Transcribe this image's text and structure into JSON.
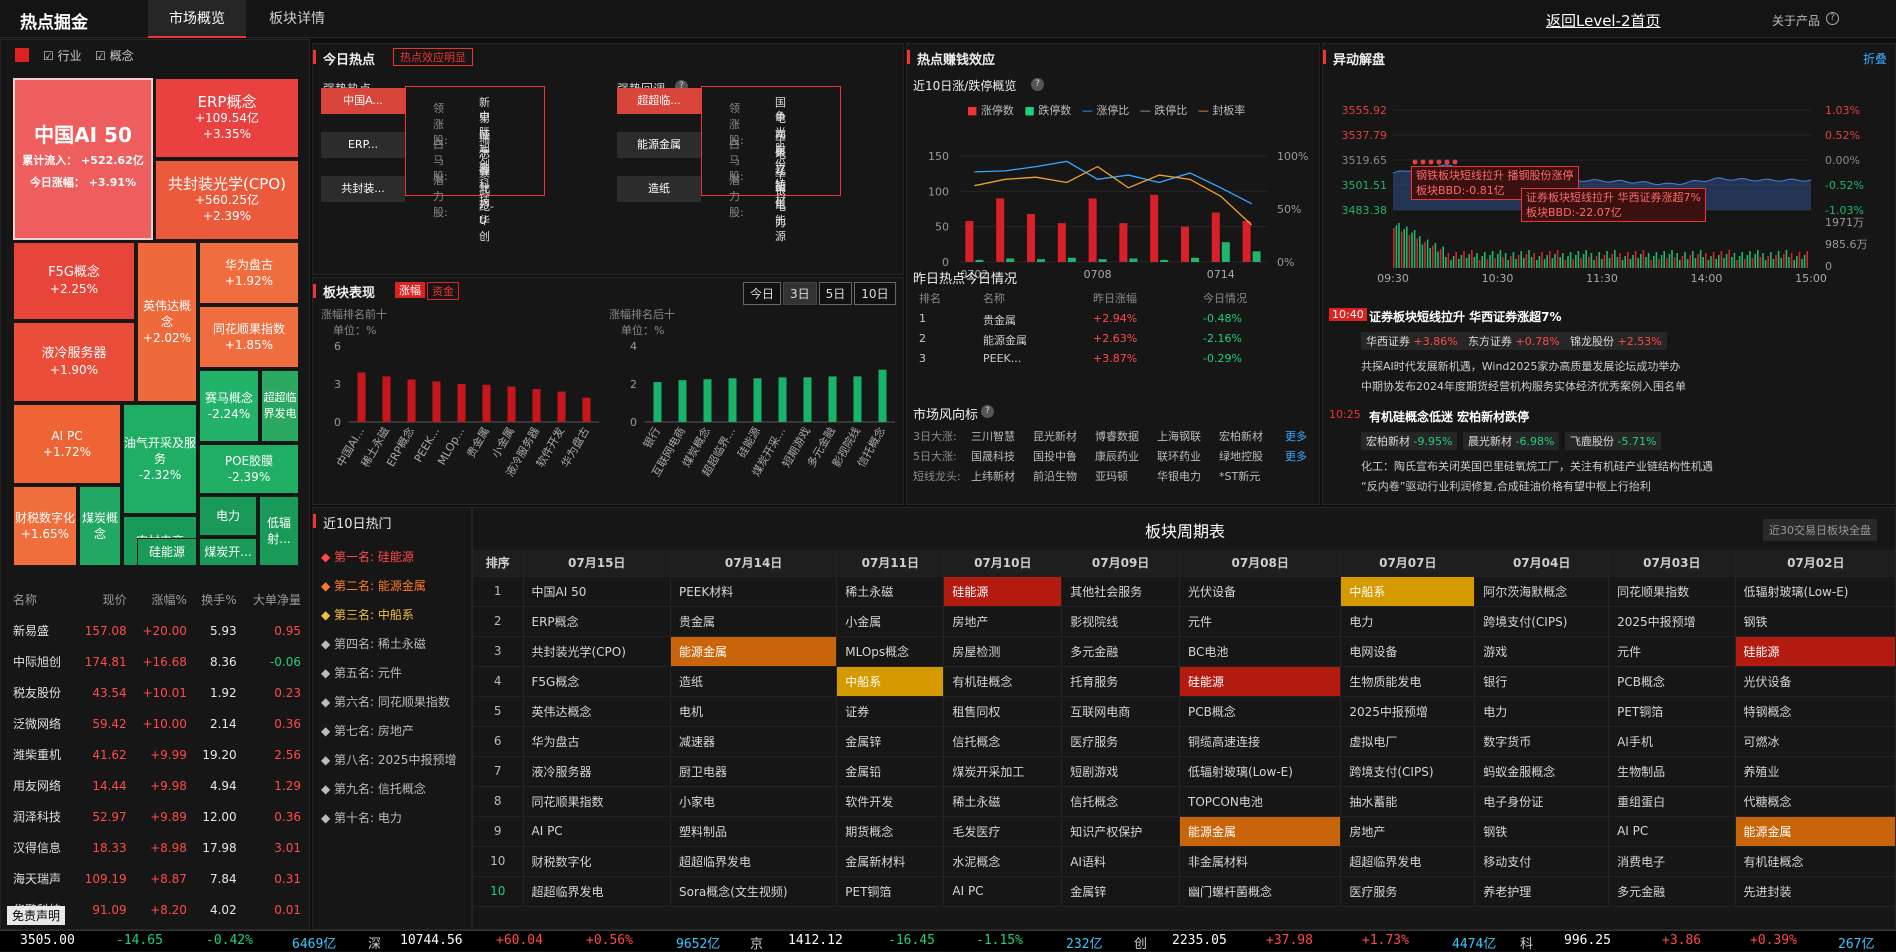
{
  "app": {
    "title": "热点掘金",
    "tabs": [
      "市场概览",
      "板块详情"
    ],
    "back_link": "返回Level-2首页",
    "about": "关于产品",
    "help": "?"
  },
  "left": {
    "filters": [
      "行业",
      "概念"
    ],
    "treemap": [
      {
        "name": "中国AI 50",
        "l1": "累计流入：",
        "v1": "+522.62亿",
        "l2": "今日涨幅：",
        "v2": "+3.91%"
      },
      {
        "name": "ERP概念",
        "v1": "+109.54亿",
        "v2": "+3.35%"
      },
      {
        "name": "共封装光学(CPO)",
        "v1": "+560.25亿",
        "v2": "+2.39%"
      },
      {
        "name": "F5G概念",
        "v1": "+2.25%"
      },
      {
        "name": "英伟达概念",
        "v1": "+2.02%"
      },
      {
        "name": "华为盘古",
        "v1": "+1.92%"
      },
      {
        "name": "同花顺果指数",
        "v1": "+1.85%"
      },
      {
        "name": "液冷服务器",
        "v1": "+1.90%"
      },
      {
        "name": "赛马概念",
        "v1": "-2.24%"
      },
      {
        "name": "超超临界发电",
        "v1": ""
      },
      {
        "name": "AI PC",
        "v1": "+1.72%"
      },
      {
        "name": "油气开采及服务",
        "v1": "-2.32%"
      },
      {
        "name": "POE胶膜",
        "v1": "-2.39%"
      },
      {
        "name": "财税数字化",
        "v1": "+1.65%"
      },
      {
        "name": "煤炭概念",
        "v1": ""
      },
      {
        "name": "农村电商",
        "v1": ""
      },
      {
        "name": "电力",
        "v1": ""
      },
      {
        "name": "低辐射...",
        "v1": ""
      },
      {
        "name": "硅能源",
        "v1": ""
      },
      {
        "name": "煤炭开...",
        "v1": ""
      }
    ],
    "stock_headers": [
      "名称",
      "现价",
      "涨幅%",
      "换手%",
      "大单净量"
    ],
    "stocks": [
      [
        "新易盛",
        "157.08",
        "+20.00",
        "5.93",
        "0.95"
      ],
      [
        "中际旭创",
        "174.81",
        "+16.68",
        "8.36",
        "-0.06"
      ],
      [
        "税友股份",
        "43.54",
        "+10.01",
        "1.92",
        "0.23"
      ],
      [
        "泛微网络",
        "59.42",
        "+10.00",
        "2.14",
        "0.36"
      ],
      [
        "潍柴重机",
        "41.62",
        "+9.99",
        "19.20",
        "2.56"
      ],
      [
        "用友网络",
        "14.44",
        "+9.98",
        "4.94",
        "1.29"
      ],
      [
        "润泽科技",
        "52.97",
        "+9.89",
        "12.00",
        "0.36"
      ],
      [
        "汉得信息",
        "18.33",
        "+8.98",
        "17.98",
        "3.01"
      ],
      [
        "海天瑞声",
        "109.19",
        "+8.87",
        "7.84",
        "0.31"
      ],
      [
        "华鹏科技",
        "91.09",
        "+8.20",
        "4.02",
        "0.01"
      ]
    ],
    "disclaimer": "免责声明"
  },
  "hot": {
    "title": "今日热点",
    "badge": "热点效应明显",
    "strong_label": "强势热点",
    "pullback_label": "强势回调",
    "strong": [
      "中国A...",
      "ERP...",
      "共封装..."
    ],
    "pullback": [
      "超超临...",
      "能源金属",
      "造纸"
    ],
    "roles": [
      "领涨股:",
      "白马股:",
      "潜力股:"
    ],
    "strong_stocks": [
      [
        "新易盛",
        "中际旭创"
      ],
      [
        "瑞芯微",
        "乐鑫科技"
      ],
      [
        "寒武纪-U",
        "北方华创"
      ]
    ],
    "pull_stocks": [
      [
        "国电南自",
        "争光股份"
      ],
      [
        "华电辽能",
        "久立特材"
      ],
      [
        "华银电力",
        "华电能源"
      ]
    ]
  },
  "money": {
    "title": "热点赚钱效应",
    "sub": "近10日涨/跌停概览",
    "legend": [
      "涨停数",
      "跌停数",
      "涨停比",
      "跌停比",
      "封板率"
    ],
    "left_ticks": [
      "150",
      "100",
      "50",
      "0"
    ],
    "right_ticks": [
      "100%",
      "50%",
      "0%"
    ],
    "x_ticks": [
      "0702",
      "0708",
      "0714"
    ],
    "yest_title": "昨日热点今日情况",
    "yest_headers": [
      "排名",
      "名称",
      "昨日涨幅",
      "今日情况"
    ],
    "yest_rows": [
      [
        "1",
        "贵金属",
        "+2.94%",
        "-0.48%"
      ],
      [
        "2",
        "能源金属",
        "+2.63%",
        "-2.16%"
      ],
      [
        "3",
        "PEEK...",
        "+3.87%",
        "-0.29%"
      ]
    ],
    "wind_title": "市场风向标",
    "wind_rows": [
      {
        "label": "3日大涨:",
        "items": [
          "三川智慧",
          "昆光新材",
          "博睿数据",
          "上海钢联",
          "宏柏新材"
        ],
        "more": "更多"
      },
      {
        "label": "5日大涨:",
        "items": [
          "国晟科技",
          "国投中鲁",
          "康辰药业",
          "联环药业",
          "绿地控股"
        ],
        "more": "更多"
      },
      {
        "label": "短线龙头:",
        "items": [
          "上纬新材",
          "前沿生物",
          "亚玛顿",
          "华银电力",
          "*ST新元"
        ],
        "more": ""
      }
    ]
  },
  "perf": {
    "title": "板块表现",
    "tab1": "涨幅",
    "tab2": "资金",
    "periods": [
      "今日",
      "3日",
      "5日",
      "10日"
    ],
    "top_label": "涨幅排名前十",
    "bottom_label": "涨幅排名后十",
    "unit": "单位：%",
    "top_ticks": [
      "6",
      "3",
      "0"
    ],
    "bot_ticks": [
      "4",
      "2",
      "0"
    ],
    "top_names": [
      "中国AI...",
      "稀土永磁",
      "ERP概念",
      "PEEK...",
      "MLOp...",
      "贵金属",
      "小金属",
      "液冷服务器",
      "软件开发",
      "华为盘古"
    ],
    "bot_names": [
      "银行",
      "互联网电商",
      "煤炭概念",
      "超超临界...",
      "硅能源",
      "煤炭开采...",
      "短期游戏",
      "多元金融",
      "影视院线",
      "信托概念"
    ]
  },
  "chart_data": [
    {
      "type": "bar",
      "title": "涨幅排名前十",
      "ylabel": "单位：%",
      "categories": [
        "中国AI...",
        "稀土永磁",
        "ERP概念",
        "PEEK...",
        "MLOp...",
        "贵金属",
        "小金属",
        "液冷服务器",
        "软件开发",
        "华为盘古"
      ],
      "values": [
        3.91,
        3.6,
        3.35,
        3.2,
        3.0,
        2.94,
        2.8,
        2.6,
        2.4,
        1.92
      ],
      "ylim": [
        0,
        6
      ]
    },
    {
      "type": "bar",
      "title": "涨幅排名后十",
      "ylabel": "单位：%",
      "categories": [
        "银行",
        "互联网电商",
        "煤炭概念",
        "超超临界...",
        "硅能源",
        "煤炭开采...",
        "短期游戏",
        "多元金融",
        "影视院线",
        "信托概念"
      ],
      "values": [
        2.1,
        2.2,
        2.25,
        2.3,
        2.3,
        2.35,
        2.35,
        2.4,
        2.4,
        2.75
      ],
      "ylim": [
        0,
        4
      ]
    },
    {
      "type": "bar",
      "title": "近10日涨/跌停概览",
      "x": [
        "0702",
        "0703",
        "0704",
        "0707",
        "0708",
        "0709",
        "0710",
        "0711",
        "0714",
        "0715"
      ],
      "series": [
        {
          "name": "涨停数",
          "values": [
            58,
            90,
            68,
            55,
            90,
            55,
            95,
            50,
            70,
            58
          ]
        },
        {
          "name": "跌停数",
          "values": [
            3,
            5,
            4,
            6,
            4,
            5,
            3,
            6,
            28,
            15
          ]
        }
      ],
      "ylim": [
        0,
        150
      ]
    },
    {
      "type": "line",
      "x": [
        "0702",
        "0703",
        "0704",
        "0707",
        "0708",
        "0709",
        "0710",
        "0711",
        "0714",
        "0715"
      ],
      "series": [
        {
          "name": "涨停比",
          "values": [
            85,
            86,
            90,
            95,
            78,
            82,
            75,
            84,
            70,
            55
          ]
        },
        {
          "name": "封板率",
          "values": [
            72,
            78,
            80,
            75,
            90,
            70,
            82,
            78,
            62,
            35
          ]
        }
      ],
      "ylim": [
        0,
        100
      ]
    },
    {
      "type": "line",
      "title": "异动解盘",
      "x": [
        "09:30",
        "10:30",
        "11:30",
        "14:00",
        "15:00"
      ],
      "ylim": [
        3483.38,
        3555.92
      ],
      "series": [
        {
          "name": "指数",
          "values": [
            3510,
            3516,
            3512,
            3508,
            3505,
            3504,
            3502,
            3506,
            3505,
            3505
          ]
        }
      ]
    }
  ],
  "anomaly": {
    "title": "异动解盘",
    "fold": "折叠",
    "left_ticks": [
      "3555.92",
      "3537.79",
      "3519.65",
      "3501.51",
      "3483.38"
    ],
    "right_ticks": [
      "1.03%",
      "0.52%",
      "0.00%",
      "-0.52%",
      "-1.03%"
    ],
    "vol_ticks": [
      "1971万",
      "985.6万",
      "0"
    ],
    "x_ticks": [
      "09:30",
      "10:30",
      "11:30",
      "14:00",
      "15:00"
    ],
    "ann1_a": "钢铁板块短线拉升 播钢股份涨停",
    "ann1_b": "板块BBD:-0.81亿",
    "ann2_a": "证券板块短线拉升 华西证券涨超7%",
    "ann2_b": "板块BBD:-22.07亿",
    "news": [
      {
        "time": "10:40",
        "title": "证券板块短线拉升 华西证券涨超7%",
        "chips": [
          [
            "华西证券",
            "+3.86%"
          ],
          [
            "东方证券",
            "+0.78%"
          ],
          [
            "锦龙股份",
            "+2.53%"
          ]
        ],
        "lines": [
          "共探AI时代发展新机遇，Wind2025家办高质量发展论坛成功举办",
          "中期协发布2024年度期货经营机构服务实体经济优秀案例入围名单"
        ]
      },
      {
        "time": "10:25",
        "title": "有机硅概念低迷 宏柏新材跌停",
        "chips": [
          [
            "宏柏新材",
            "-9.95%"
          ],
          [
            "晨光新材",
            "-6.98%"
          ],
          [
            "飞鹿股份",
            "-5.71%"
          ]
        ],
        "lines": [
          "化工：陶氏宣布关闭英国巴里硅氧烷工厂，关注有机硅产业链结构性机遇",
          "“反内卷”驱动行业利润修复,合成硅油价格有望中枢上行抬利"
        ]
      }
    ]
  },
  "recent": {
    "title": "近10日热门",
    "items": [
      "第一名: 硅能源",
      "第二名: 能源金属",
      "第三名: 中船系",
      "第四名: 稀土永磁",
      "第五名: 元件",
      "第六名: 同花顺果指数",
      "第七名: 房地产",
      "第八名: 2025中报预增",
      "第九名: 信托概念",
      "第十名: 电力"
    ]
  },
  "cycle": {
    "title": "板块周期表",
    "btn": "近30交易日板块全盘",
    "headers": [
      "排序",
      "07月15日",
      "07月14日",
      "07月11日",
      "07月10日",
      "07月09日",
      "07月08日",
      "07月07日",
      "07月04日",
      "07月03日",
      "07月02日"
    ],
    "rows": [
      [
        "1",
        "中国AI 50",
        "PEEK材料",
        "稀土永磁",
        "硅能源",
        "其他社会服务",
        "光伏设备",
        "中船系",
        "阿尔茨海默概念",
        "同花顺果指数",
        "低辐射玻璃(Low-E)"
      ],
      [
        "2",
        "ERP概念",
        "贵金属",
        "小金属",
        "房地产",
        "影视院线",
        "元件",
        "电力",
        "跨境支付(CIPS)",
        "2025中报预增",
        "钢铁"
      ],
      [
        "3",
        "共封装光学(CPO)",
        "能源金属",
        "MLOps概念",
        "房屋检测",
        "多元金融",
        "BC电池",
        "电网设备",
        "游戏",
        "元件",
        "硅能源"
      ],
      [
        "4",
        "F5G概念",
        "造纸",
        "中船系",
        "有机硅概念",
        "托育服务",
        "硅能源",
        "生物质能发电",
        "银行",
        "PCB概念",
        "光伏设备"
      ],
      [
        "5",
        "英伟达概念",
        "电机",
        "证券",
        "租售同权",
        "互联网电商",
        "PCB概念",
        "2025中报预增",
        "电力",
        "PET铜箔",
        "特钢概念"
      ],
      [
        "6",
        "华为盘古",
        "减速器",
        "金属锌",
        "信托概念",
        "医疗服务",
        "铜缆高速连接",
        "虚拟电厂",
        "数字货币",
        "AI手机",
        "可燃冰"
      ],
      [
        "7",
        "液冷服务器",
        "厨卫电器",
        "金属铅",
        "煤炭开采加工",
        "短剧游戏",
        "低辐射玻璃(Low-E)",
        "跨境支付(CIPS)",
        "蚂蚁金服概念",
        "生物制品",
        "养殖业"
      ],
      [
        "8",
        "同花顺果指数",
        "小家电",
        "软件开发",
        "稀土永磁",
        "信托概念",
        "TOPCON电池",
        "抽水蓄能",
        "电子身份证",
        "重组蛋白",
        "代糖概念"
      ],
      [
        "9",
        "AI PC",
        "塑料制品",
        "期货概念",
        "毛发医疗",
        "知识产权保护",
        "能源金属",
        "房地产",
        "钢铁",
        "AI PC",
        "能源金属"
      ],
      [
        "10",
        "财税数字化",
        "超超临界发电",
        "金属新材料",
        "水泥概念",
        "AI语料",
        "非金属材料",
        "超超临界发电",
        "移动支付",
        "消费电子",
        "有机硅概念"
      ],
      [
        "10",
        "超超临界发电",
        "Sora概念(文生视频)",
        "PET铜箔",
        "AI PC",
        "金属锌",
        "幽门螺杆菌概念",
        "医疗服务",
        "养老护理",
        "多元金融",
        "先进封装"
      ]
    ]
  },
  "ticker": {
    "sh": [
      "3505.00",
      "-14.65",
      "-0.42%",
      "6469亿"
    ],
    "sz_label": "深",
    "sz": [
      "10744.56",
      "+60.04",
      "+0.56%",
      "9652亿"
    ],
    "bj_label": "京",
    "bj": [
      "1412.12",
      "-16.45",
      "-1.15%",
      "232亿"
    ],
    "cy_label": "创",
    "cy": [
      "2235.05",
      "+37.98",
      "+1.73%",
      "4474亿"
    ],
    "kc_label": "科",
    "kc": [
      "996.25",
      "+3.86",
      "+0.39%",
      "267亿"
    ]
  },
  "colors": {
    "up": "#ff4a4a",
    "down": "#1fd17a",
    "accent": "#e33",
    "bar_up": "#c8161d",
    "bar_dn": "#19b46b"
  }
}
